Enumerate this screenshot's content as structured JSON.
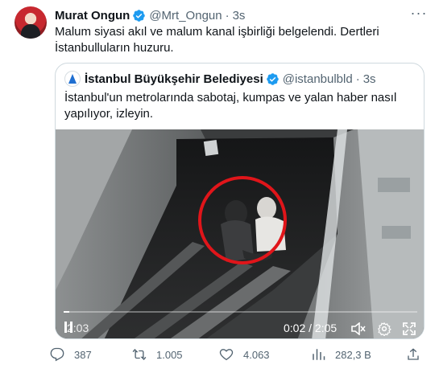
{
  "author": {
    "name": "Murat Ongun",
    "handle": "@Mrt_Ongun",
    "separator": "·",
    "time": "3s"
  },
  "tweet_text": "Malum siyasi akıl ve malum kanal işbirliği belgelendi. Dertleri İstanbulluların huzuru.",
  "quoted": {
    "name": "İstanbul Büyükşehir Belediyesi",
    "handle": "@istanbulbld",
    "separator": "·",
    "time": "3s",
    "text": "İstanbul'un metrolarında sabotaj, kumpas ve yalan haber nasıl yapılıyor, izleyin."
  },
  "video": {
    "current_time": "0:02",
    "duration": "2:05",
    "time_display": "0:02 / 2:05",
    "progress_fraction": 0.016,
    "overlay_time_left": "2:03"
  },
  "actions": {
    "replies": "387",
    "retweets": "1.005",
    "likes": "4.063",
    "views": "282,3 B"
  },
  "colors": {
    "verified_blue": "#1d9bf0",
    "text_secondary": "#536471",
    "highlight_circle": "#e0151a"
  },
  "icons": [
    "verified-badge-icon",
    "more-icon",
    "play-pause-icon",
    "volume-muted-icon",
    "settings-gear-icon",
    "fullscreen-icon",
    "reply-icon",
    "retweet-icon",
    "like-icon",
    "views-icon",
    "share-icon"
  ]
}
